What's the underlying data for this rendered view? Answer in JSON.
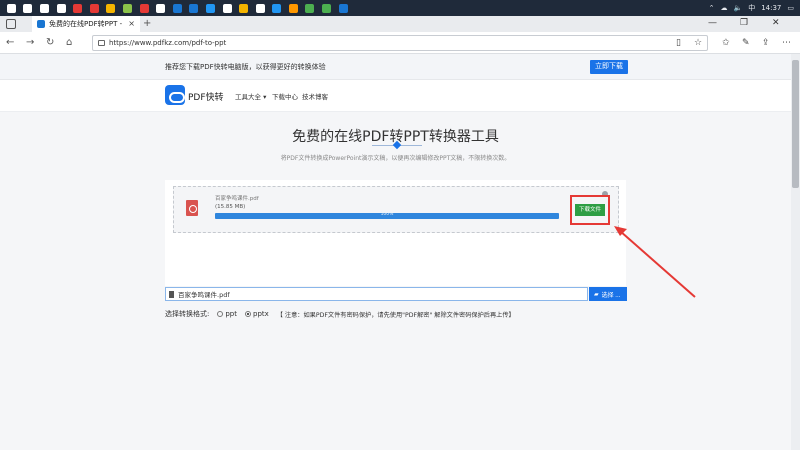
{
  "taskbar": {
    "icons": [
      {
        "name": "start-icon",
        "color": "#ffffff"
      },
      {
        "name": "search-icon",
        "color": "#ffffff"
      },
      {
        "name": "cortana-icon",
        "color": "#ffffff"
      },
      {
        "name": "task-view-icon",
        "color": "#ffffff"
      },
      {
        "name": "app-icon-1",
        "color": "#e53935"
      },
      {
        "name": "app-icon-2",
        "color": "#e53935"
      },
      {
        "name": "app-icon-3",
        "color": "#f4b400"
      },
      {
        "name": "app-icon-4",
        "color": "#8bc34a"
      },
      {
        "name": "app-icon-5",
        "color": "#e53935"
      },
      {
        "name": "app-icon-6",
        "color": "#ffffff"
      },
      {
        "name": "app-icon-7",
        "color": "#1976d2"
      },
      {
        "name": "app-icon-8",
        "color": "#1976d2"
      },
      {
        "name": "app-icon-9",
        "color": "#2196f3"
      },
      {
        "name": "app-icon-10",
        "color": "#ffffff"
      },
      {
        "name": "chrome-icon",
        "color": "#f4b400"
      },
      {
        "name": "app-icon-11",
        "color": "#ffffff"
      },
      {
        "name": "app-icon-12",
        "color": "#2196f3"
      },
      {
        "name": "app-icon-13",
        "color": "#ff9800"
      },
      {
        "name": "wechat-icon",
        "color": "#4caf50"
      },
      {
        "name": "app-icon-14",
        "color": "#4caf50"
      },
      {
        "name": "app-icon-15",
        "color": "#1976d2"
      }
    ],
    "clock": "14:37",
    "ime": "中"
  },
  "browser": {
    "tab_title": "免费的在线PDF转PPT -",
    "tab_close": "×",
    "new_tab": "+",
    "url": "https://www.pdfkz.com/pdf-to-ppt"
  },
  "page": {
    "promo_text": "推荐您下载PDF快转电脑版，以获得更好的转换体验",
    "promo_button": "立即下载",
    "brand": "PDF快转",
    "nav": [
      "工具大全 ▾",
      "下载中心",
      "技术博客"
    ],
    "title": "免费的在线PDF转PPT转换器工具",
    "subtitle": "将PDF文件转换成PowerPoint演示文稿，以便再次编辑修改PPT文稿，不限转换次数。",
    "file": {
      "name": "百家争鸣课件.pdf",
      "size": "(15.85 MB)",
      "progress_percent": 100,
      "progress_label": "100%",
      "download_button": "下载文件"
    },
    "file_input_value": "百家争鸣课件.pdf",
    "choose_button": "选择 ...",
    "format_label": "选择转换格式:",
    "formats": [
      {
        "label": "ppt",
        "checked": false
      },
      {
        "label": "pptx",
        "checked": true
      }
    ],
    "notice": "【 注意：如果PDF文件有密码保护，请先使用\"PDF解密\" 解除文件密码保护后再上传】"
  },
  "colors": {
    "accent": "#1a73e8",
    "download_green": "#2e9e44",
    "highlight_red": "#e53935"
  }
}
